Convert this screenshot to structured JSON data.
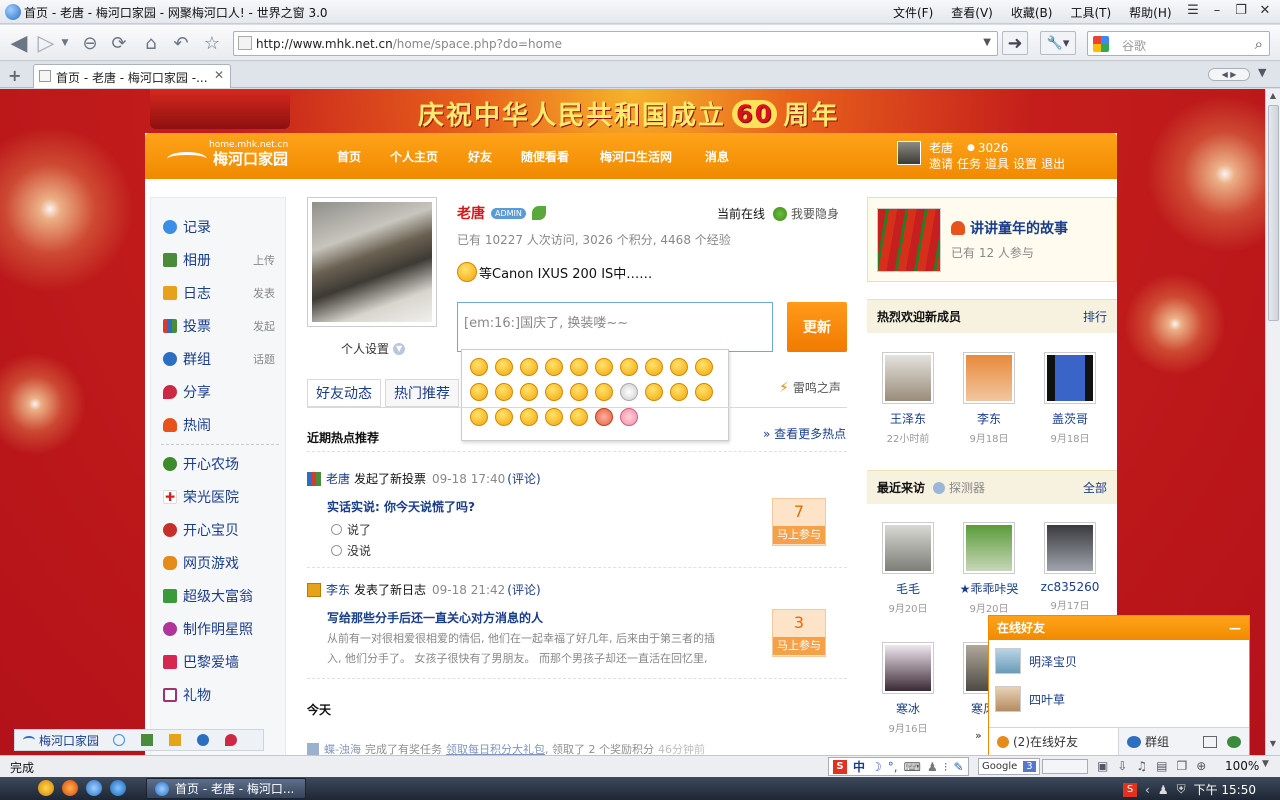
{
  "window": {
    "title": "首页 - 老唐 - 梅河口家园 - 网聚梅河口人! - 世界之窗 3.0",
    "menu": [
      "文件(F)",
      "查看(V)",
      "收藏(B)",
      "工具(T)",
      "帮助(H)"
    ]
  },
  "browser": {
    "url_host": "http://www.mhk.net.cn",
    "url_path": "/home/space.php?do=home",
    "search_placeholder": "谷歌",
    "tab_label": "首页 - 老唐 - 梅河口家园 -..."
  },
  "banner": {
    "text_before": "庆祝中华人民共和国成立",
    "number": "60",
    "text_after": "周年"
  },
  "site": {
    "logo_domain": "home.mhk.net.cn",
    "logo_name": "梅河口家园",
    "nav": [
      "首页",
      "个人主页",
      "好友",
      "随便看看",
      "梅河口生活网",
      "消息"
    ],
    "user": {
      "name": "老唐",
      "points": "3026",
      "links": [
        "邀请",
        "任务",
        "道具",
        "设置",
        "退出"
      ]
    }
  },
  "sidebar": {
    "items": [
      {
        "label": "记录",
        "side": "",
        "color": "#3b8ee6"
      },
      {
        "label": "相册",
        "side": "上传",
        "color": "#4a8c3a"
      },
      {
        "label": "日志",
        "side": "发表",
        "color": "#e6a21a"
      },
      {
        "label": "投票",
        "side": "发起",
        "color": "#d93a2b"
      },
      {
        "label": "群组",
        "side": "话题",
        "color": "#2c6fc0"
      },
      {
        "label": "分享",
        "side": "",
        "color": "#cc2a44"
      },
      {
        "label": "热闹",
        "side": "",
        "color": "#e8531b"
      }
    ],
    "apps": [
      {
        "label": "开心农场",
        "color": "#3d8b2a"
      },
      {
        "label": "荣光医院",
        "color": "#d82020"
      },
      {
        "label": "开心宝贝",
        "color": "#c7302a"
      },
      {
        "label": "网页游戏",
        "color": "#e48b1a"
      },
      {
        "label": "超级大富翁",
        "color": "#3a9a3a"
      },
      {
        "label": "制作明星照",
        "color": "#b0349a"
      },
      {
        "label": "巴黎爱墙",
        "color": "#d7264f"
      },
      {
        "label": "礼物",
        "color": "#a5306f"
      }
    ]
  },
  "profile": {
    "name": "老唐",
    "badge": "ADMIN",
    "online_label": "当前在线",
    "hide_label": "我要隐身",
    "stats": "已有 10227 人次访问, 3026 个积分, 4468 个经验",
    "status": "等Canon IXUS 200 IS中……",
    "settings_label": "个人设置",
    "input_value": "[em:16:]国庆了, 换装喽~~",
    "update_label": "更新"
  },
  "tabs": [
    "好友动态",
    "热门推荐"
  ],
  "thunder_label": "雷鸣之声",
  "hot": {
    "title": "近期热点推荐",
    "more": "» 查看更多热点"
  },
  "feed": [
    {
      "user": "老唐",
      "action": "发起了新投票",
      "time": "09-18 17:40",
      "comment": "(评论)",
      "title": "实话实说: 你今天说慌了吗?",
      "options": [
        "说了",
        "没说"
      ],
      "count": "7",
      "join": "马上参与"
    },
    {
      "user": "李东",
      "action": "发表了新日志",
      "time": "09-18 21:42",
      "comment": "(评论)",
      "title": "写给那些分手后还一直关心对方消息的人",
      "summary1": "从前有一对很相爱很相爱的情侣, 他们在一起幸福了好几年, 后来由于第三者的插",
      "summary2": "入, 他们分手了。 女孩子很快有了男朋友。 而那个男孩子却还一直活在回忆里,",
      "count": "3",
      "join": "马上参与"
    }
  ],
  "today": {
    "label": "今天",
    "item_user": "蝶-浊海",
    "item_action": "完成了有奖任务",
    "item_link": "领取每日积分大礼包",
    "item_rest": ", 领取了 2 个奖励积分",
    "item_time": "46分钟前"
  },
  "story": {
    "title": "讲讲童年的故事",
    "count": "已有 12 人参与"
  },
  "new_members": {
    "title": "热烈欢迎新成员",
    "more": "排行",
    "list": [
      {
        "name": "王泽东",
        "time": "22小时前"
      },
      {
        "name": "李东",
        "time": "9月18日"
      },
      {
        "name": "盖茨哥",
        "time": "9月18日"
      }
    ]
  },
  "visitors": {
    "title": "最近来访",
    "detector": "探测器",
    "more": "全部",
    "list": [
      {
        "name": "毛毛",
        "time": "9月20日"
      },
      {
        "name": "★乖乖咔哭",
        "time": "9月20日"
      },
      {
        "name": "zc835260",
        "time": "9月17日"
      },
      {
        "name": "寒冰",
        "time": "9月16日"
      },
      {
        "name": "寒风影",
        "time": ""
      }
    ]
  },
  "online_friends": {
    "title": "在线好友",
    "list": [
      "明泽宝贝",
      "四叶草"
    ],
    "count_label": "(2)在线好友",
    "group_label": "群组"
  },
  "bottom_tool": {
    "label": "梅河口家园"
  },
  "statusbar": {
    "status": "完成",
    "zoom": "100%",
    "google": "Google",
    "ime": "中"
  },
  "taskbar": {
    "task": "首页 - 老唐 - 梅河口...",
    "time": "下午 15:50"
  }
}
